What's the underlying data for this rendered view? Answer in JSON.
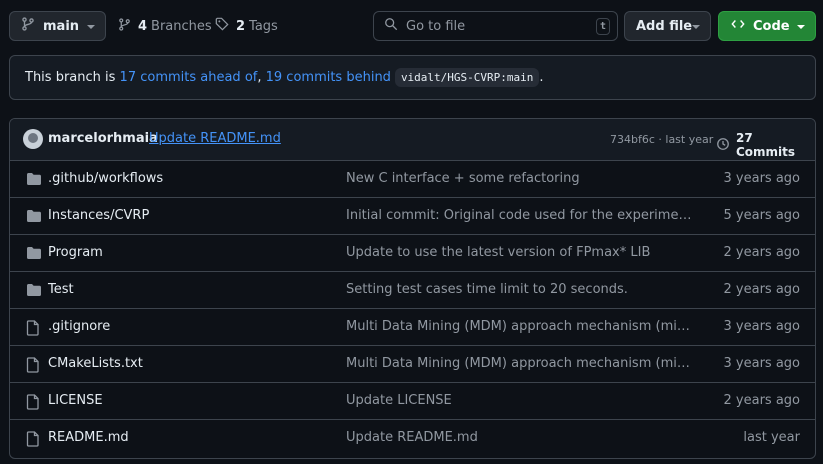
{
  "toolbar": {
    "branch_label": "main",
    "branches_count": "4",
    "branches_label": "Branches",
    "tags_count": "2",
    "tags_label": "Tags",
    "search_placeholder": "Go to file",
    "search_shortcut": "t",
    "add_file_label": "Add file",
    "code_label": "Code"
  },
  "banner": {
    "prefix": "This branch is ",
    "ahead_link": "17 commits ahead of",
    "separator": ", ",
    "behind_link": "19 commits behind",
    "upstream": "vidalt/HGS-CVRP:main",
    "suffix": "."
  },
  "latest_commit": {
    "author": "marcelorhmaia",
    "message": "Update README.md",
    "meta": "734bf6c · last year",
    "commits_label": "27 Commits"
  },
  "files": [
    {
      "name": ".github/workflows",
      "type": "folder",
      "message": "New C interface + some refactoring",
      "date": "3 years ago"
    },
    {
      "name": "Instances/CVRP",
      "type": "folder",
      "message": "Initial commit: Original code used for the experiments of the paper",
      "date": "5 years ago"
    },
    {
      "name": "Program",
      "type": "folder",
      "message": "Update to use the latest version of FPmax* LIB",
      "date": "2 years ago"
    },
    {
      "name": "Test",
      "type": "folder",
      "message": "Setting test cases time limit to 20 seconds.",
      "date": "2 years ago"
    },
    {
      "name": ".gitignore",
      "type": "file",
      "message": "Multi Data Mining (MDM) approach mechanism (mines patterns)",
      "date": "3 years ago"
    },
    {
      "name": "CMakeLists.txt",
      "type": "file",
      "message": "Multi Data Mining (MDM) approach mechanism (mines patterns)",
      "date": "3 years ago"
    },
    {
      "name": "LICENSE",
      "type": "file",
      "message": "Update LICENSE",
      "date": "2 years ago"
    },
    {
      "name": "README.md",
      "type": "file",
      "message": "Update README.md",
      "date": "last year"
    }
  ],
  "colors": {
    "background": "#0d1117",
    "border": "#3d444d",
    "link": "#4493f8",
    "muted": "#9198a1",
    "code_button": "#238636"
  }
}
